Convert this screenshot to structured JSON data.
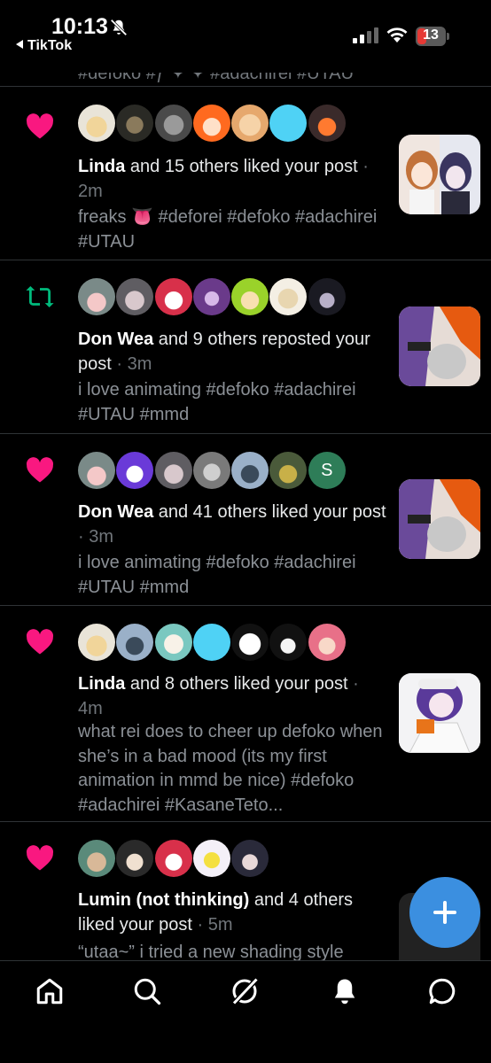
{
  "status_bar": {
    "time": "10:13",
    "back_app": "TikTok",
    "battery": "13"
  },
  "cut_off_text": "#defoko #ƒ ✦ ✦ #adachirei #UTAU",
  "notifications": [
    {
      "type": "like",
      "icon": "heart-icon",
      "name": "Linda",
      "action": " and 15 others liked your post",
      "time": " · 2m",
      "body": "freaks 👅 #deforei #defoko #adachirei #UTAU"
    },
    {
      "type": "repost",
      "icon": "repost-icon",
      "name": "Don Wea",
      "action": " and 9 others reposted your post",
      "time": " · 3m",
      "body": "i love animating #defoko #adachirei #UTAU #mmd"
    },
    {
      "type": "like",
      "icon": "heart-icon",
      "name": "Don Wea",
      "action": " and 41 others liked your post",
      "time": " · 3m",
      "body": "i love animating #defoko #adachirei #UTAU #mmd",
      "letter_avatar": "S"
    },
    {
      "type": "like",
      "icon": "heart-icon",
      "name": "Linda",
      "action": " and 8 others liked your post",
      "time": " · 4m",
      "body": "what rei does to cheer up defoko when she’s in a bad mood (its my first animation in mmd be nice) #defoko #adachirei #KasaneTeto..."
    },
    {
      "type": "like",
      "icon": "heart-icon",
      "name": "Lumin (not thinking)",
      "action": " and 4 others liked your post",
      "time": " · 5m",
      "body": "“utaa~” i tried a new shading style"
    }
  ],
  "colors": {
    "heart": "#f91880",
    "repost": "#00ba7c",
    "fab": "#3b8fe0",
    "text_dim": "#71767b"
  },
  "bottom_nav": [
    "home-icon",
    "search-icon",
    "grok-icon",
    "notifications-icon",
    "messages-icon"
  ]
}
